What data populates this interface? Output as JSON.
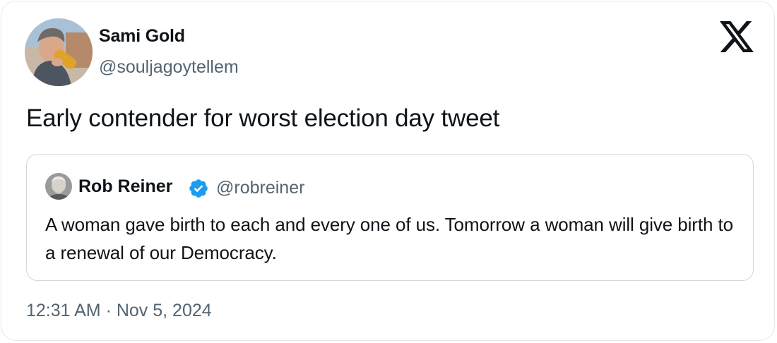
{
  "tweet": {
    "author": {
      "name": "Sami Gold",
      "handle": "@souljagoytellem"
    },
    "text": "Early contender for worst election day tweet",
    "timestamp": "12:31 AM · Nov 5, 2024",
    "platform_icon": "x-logo-icon"
  },
  "quoted_tweet": {
    "author": {
      "name": "Rob Reiner",
      "handle": "@robreiner",
      "verified": true,
      "verified_icon": "verified-badge-icon"
    },
    "text": "A woman gave birth to each and every one of us. Tomorrow a woman will give birth to a renewal of our Democracy."
  },
  "colors": {
    "text_primary": "#0f1419",
    "text_secondary": "#536471",
    "border": "#cfd9de",
    "verified_blue": "#1d9bf0"
  }
}
